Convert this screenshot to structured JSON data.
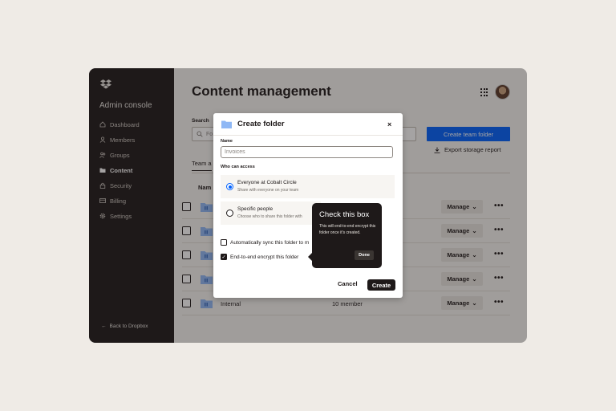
{
  "sidebar": {
    "admin_title": "Admin console",
    "items": [
      {
        "label": "Dashboard",
        "icon": "home-icon"
      },
      {
        "label": "Members",
        "icon": "person-icon"
      },
      {
        "label": "Groups",
        "icon": "people-icon"
      },
      {
        "label": "Content",
        "icon": "folder-icon",
        "active": true
      },
      {
        "label": "Security",
        "icon": "lock-icon"
      },
      {
        "label": "Billing",
        "icon": "card-icon"
      },
      {
        "label": "Settings",
        "icon": "gear-icon"
      }
    ],
    "back_link": "Back to Dropbox"
  },
  "main": {
    "title": "Content management",
    "search_label": "Search",
    "search_placeholder": "Fo",
    "create_team_folder": "Create team folder",
    "export_storage_report": "Export storage report",
    "tab": "Team a",
    "column_name": "Nam",
    "rows": [
      {
        "name": "",
        "members": "",
        "manage": "Manage"
      },
      {
        "name": "",
        "members": "",
        "manage": "Manage"
      },
      {
        "name": "",
        "members": "",
        "manage": "Manage"
      },
      {
        "name": "",
        "members": "",
        "manage": "Manage"
      },
      {
        "name": "Internal",
        "members": "10 member",
        "manage": "Manage"
      }
    ]
  },
  "modal": {
    "title": "Create folder",
    "close": "×",
    "name_label": "Name",
    "name_placeholder": "Invoices",
    "access_label": "Who can access",
    "options": [
      {
        "title": "Everyone at Cobalt Circle",
        "desc": "Share with everyone on your team",
        "checked": true
      },
      {
        "title": "Specific people",
        "desc": "Choose who to share this folder with",
        "checked": false
      }
    ],
    "sync_label": "Automatically sync this folder to m",
    "encrypt_label": "End-to-end encrypt this folder",
    "cancel": "Cancel",
    "create": "Create"
  },
  "tooltip": {
    "title": "Check this box",
    "body": "This will end-to-end encrypt this folder once it's created.",
    "done": "Done"
  },
  "colors": {
    "accent_blue": "#0061fe",
    "dark": "#1e1919",
    "background": "#efebe6",
    "folder_blue": "#8fb8f5"
  }
}
